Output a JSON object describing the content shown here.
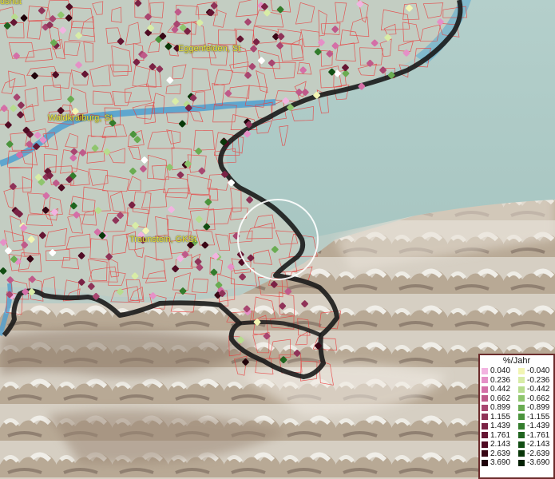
{
  "map": {
    "labels": [
      {
        "id": "eggenfelden",
        "text": "Eggenfelden, St"
      },
      {
        "id": "waldkraiburg",
        "text": "Waldkraiburg, St"
      },
      {
        "id": "traunstein",
        "text": "Traunstein, GKSt"
      },
      {
        "id": "top-left-partial",
        "text": "dshut"
      }
    ],
    "highlight": "circle"
  },
  "legend": {
    "title": "%/Jahr",
    "positive": [
      {
        "label": "0.040",
        "color": "#f2b3e0"
      },
      {
        "label": "0.236",
        "color": "#e590c7"
      },
      {
        "label": "0.442",
        "color": "#d46fa7"
      },
      {
        "label": "0.662",
        "color": "#bf5a8a"
      },
      {
        "label": "0.899",
        "color": "#a84670"
      },
      {
        "label": "1.155",
        "color": "#8f3358"
      },
      {
        "label": "1.439",
        "color": "#7a2244"
      },
      {
        "label": "1.761",
        "color": "#651633"
      },
      {
        "label": "2.143",
        "color": "#500c24"
      },
      {
        "label": "2.639",
        "color": "#380615"
      },
      {
        "label": "3.690",
        "color": "#1f020a"
      }
    ],
    "negative": [
      {
        "label": "-0.040",
        "color": "#f2f5b3"
      },
      {
        "label": "-0.236",
        "color": "#d8eca6"
      },
      {
        "label": "-0.442",
        "color": "#b7dc8e"
      },
      {
        "label": "-0.662",
        "color": "#8fc56e"
      },
      {
        "label": "-0.899",
        "color": "#6aac52"
      },
      {
        "label": "-1.155",
        "color": "#4b943d"
      },
      {
        "label": "-1.439",
        "color": "#337c2c"
      },
      {
        "label": "-1.761",
        "color": "#20641f"
      },
      {
        "label": "-2.143",
        "color": "#124d13"
      },
      {
        "label": "-2.639",
        "color": "#093709"
      },
      {
        "label": "-3.690",
        "color": "#032003"
      }
    ]
  }
}
